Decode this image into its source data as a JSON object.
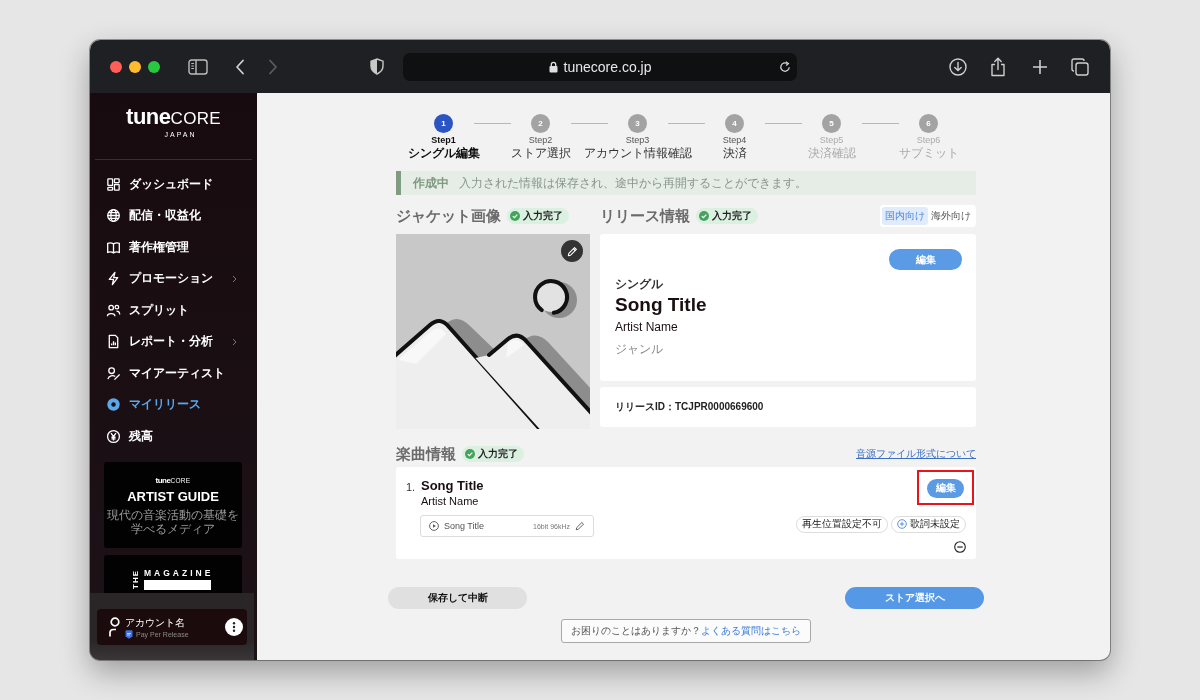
{
  "browser": {
    "url": "tunecore.co.jp"
  },
  "sidebar": {
    "logo": {
      "bold_part": "tune",
      "light_part": "CORE",
      "subtitle": "JAPAN"
    },
    "items": [
      {
        "label": "ダッシュボード",
        "selected": false,
        "has_submenu": false
      },
      {
        "label": "配信・収益化",
        "selected": false,
        "has_submenu": false
      },
      {
        "label": "著作権管理",
        "selected": false,
        "has_submenu": false
      },
      {
        "label": "プロモーション",
        "selected": false,
        "has_submenu": true
      },
      {
        "label": "スプリット",
        "selected": false,
        "has_submenu": false
      },
      {
        "label": "レポート・分析",
        "selected": false,
        "has_submenu": true
      },
      {
        "label": "マイアーティスト",
        "selected": false,
        "has_submenu": false
      },
      {
        "label": "マイリリース",
        "selected": true,
        "has_submenu": false
      },
      {
        "label": "残高",
        "selected": false,
        "has_submenu": false
      }
    ],
    "banners": [
      {
        "kind": "guide",
        "logo_bold": "tune",
        "logo_light": "CORE",
        "title": "ARTIST GUIDE",
        "lines": [
          "現代の音楽活動の基礎を",
          "学べるメディア"
        ]
      },
      {
        "kind": "magazine",
        "side_text": "THE",
        "title": "MAGAZINE"
      }
    ],
    "account": {
      "name": "アカウント名",
      "plan": "Pay Per Release"
    }
  },
  "steps": [
    {
      "number": "1",
      "step": "Step1",
      "label": "シングル編集",
      "selected": true,
      "disabled": false
    },
    {
      "number": "2",
      "step": "Step2",
      "label": "ストア選択",
      "selected": false,
      "disabled": false
    },
    {
      "number": "3",
      "step": "Step3",
      "label": "アカウント情報確認",
      "selected": false,
      "disabled": false
    },
    {
      "number": "4",
      "step": "Step4",
      "label": "決済",
      "selected": false,
      "disabled": false
    },
    {
      "number": "5",
      "step": "Step5",
      "label": "決済確認",
      "selected": false,
      "disabled": true
    },
    {
      "number": "6",
      "step": "Step6",
      "label": "サブミット",
      "selected": false,
      "disabled": true
    }
  ],
  "notice": {
    "status": "作成中",
    "message": "入力された情報は保存され、途中から再開することができます。"
  },
  "jacket": {
    "title": "ジャケット画像",
    "badge": "入力完了"
  },
  "release": {
    "title": "リリース情報",
    "badge": "入力完了",
    "regions": [
      {
        "label": "国内向け",
        "selected": true
      },
      {
        "label": "海外向け",
        "selected": false
      }
    ],
    "edit_button": "編集",
    "type": "シングル",
    "song_title": "Song Title",
    "artist": "Artist Name",
    "genre": "ジャンル",
    "release_id": "リリースID：TCJPR0000669600"
  },
  "tracks": {
    "title": "楽曲情報",
    "badge": "入力完了",
    "format_link": "音源ファイル形式について",
    "items": [
      {
        "number": "1.",
        "title": "Song Title",
        "artist": "Artist Name",
        "file_name": "Song Title",
        "file_format": "16bit 96kHz",
        "edit_button": "編集",
        "highlighted": true,
        "tags": [
          {
            "label": "再生位置設定不可",
            "kind": "status"
          },
          {
            "label": "歌詞未設定",
            "kind": "add"
          }
        ]
      }
    ]
  },
  "footer": {
    "save_button": "保存して中断",
    "next_button": "ストア選択へ",
    "help_text": "お困りのことはありますか？",
    "help_link": "よくある質問はこちら"
  }
}
